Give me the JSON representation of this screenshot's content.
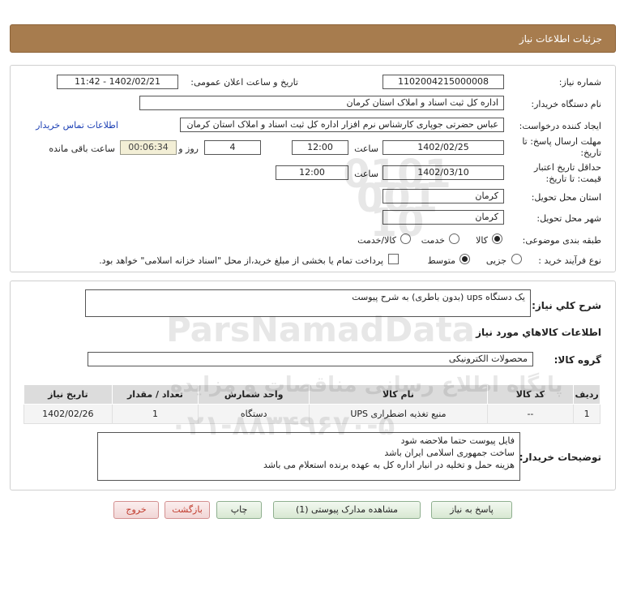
{
  "header": {
    "title": "جزئیات اطلاعات نیاز"
  },
  "form": {
    "need_number": {
      "label": "شماره نیاز:",
      "value": "1102004215000008"
    },
    "announce_datetime": {
      "label": "تاریخ و ساعت اعلان عمومی:",
      "value": "1402/02/21 - 11:42"
    },
    "buyer_org": {
      "label": "نام دستگاه خریدار:",
      "value": "اداره کل ثبت اسناد و املاک استان کرمان"
    },
    "requester": {
      "label": "ایجاد کننده درخواست:",
      "value": "عباس حضرتی جوپاری کارشناس نرم افزار اداره کل ثبت اسناد و املاک استان کرمان",
      "contact_link": "اطلاعات تماس خریدار"
    },
    "response_deadline": {
      "label": "مهلت ارسال پاسخ: تا تاریخ:",
      "date": "1402/02/25",
      "time_label": "ساعت",
      "time": "12:00",
      "days": "4",
      "days_label": "روز و",
      "remaining": "00:06:34",
      "remaining_label": "ساعت باقی مانده"
    },
    "price_validity": {
      "label_line1": "حداقل تاریخ اعتبار",
      "label_line2": "قیمت: تا تاریخ:",
      "date": "1402/03/10",
      "time_label": "ساعت",
      "time": "12:00"
    },
    "delivery_province": {
      "label": "استان محل تحویل:",
      "value": "کرمان"
    },
    "delivery_city": {
      "label": "شهر محل تحویل:",
      "value": "کرمان"
    },
    "category": {
      "label": "طبقه بندی موضوعی:",
      "options": [
        "کالا",
        "خدمت",
        "کالا/خدمت"
      ],
      "selected": "کالا"
    },
    "purchase_process": {
      "label": "نوع فرآیند خرید :",
      "options": [
        "جزیی",
        "متوسط"
      ],
      "selected": "متوسط",
      "treasury_note": "پرداخت تمام یا بخشی از مبلغ خرید،از محل \"اسناد خزانه اسلامی\" خواهد بود."
    }
  },
  "summary": {
    "label": "شرح کلي نياز:",
    "value": "یک دستگاه ups (بدون باطری) به شرح پیوست"
  },
  "goods_info": {
    "heading": "اطلاعات کالاهاي مورد نياز",
    "group_label": "گروه کالا:",
    "group_value": "محصولات الکترونیکی",
    "table": {
      "columns": [
        "ردیف",
        "کد کالا",
        "نام کالا",
        "واحد شمارش",
        "تعداد / مقدار",
        "تاریخ نیاز"
      ],
      "rows": [
        [
          "1",
          "--",
          "منبع تغذیه اضطراری UPS",
          "دستگاه",
          "1",
          "1402/02/26"
        ]
      ]
    }
  },
  "buyer_notes": {
    "label": "توضیحات خریدار:",
    "lines": [
      "فایل پیوست حتما ملاحضه شود",
      "ساخت جمهوری اسلامی ایران باشد",
      "هزینه حمل و تخلیه در انبار اداره کل به عهده برنده استعلام می باشد"
    ]
  },
  "buttons": {
    "reply": "پاسخ به نیاز",
    "attachments": "مشاهده مدارک پیوستی (1)",
    "print": "چاپ",
    "back": "بازگشت",
    "exit": "خروج"
  },
  "watermark": {
    "brand": "ParsNamadData",
    "line1": "پایگاه اطلاع رسانی مناقصات و مزایده",
    "phone": "۰۲۱-۸۸۳۴۹۶۷۰-۵",
    "big_digits": "0101 001 10"
  },
  "colors": {
    "header": "#a77c4e",
    "link": "#1b3fb4",
    "timer_bg": "#f3efd6",
    "exit_text": "#c0392b"
  }
}
